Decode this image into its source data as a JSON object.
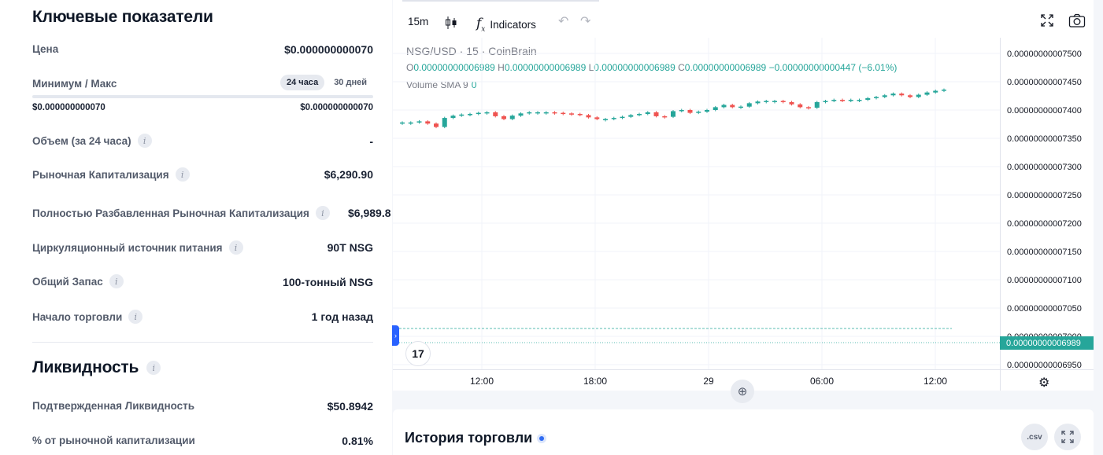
{
  "key_metrics": {
    "title": "Ключевые показатели",
    "price_label": "Цена",
    "price_value": "$0.000000000070",
    "minmax_label": "Минимум / Макс",
    "range_tabs": [
      "24 часа",
      "30 дней"
    ],
    "range_min": "$0.000000000070",
    "range_max": "$0.000000000070",
    "volume_label": "Объем (за 24 часа)",
    "volume_value": "-",
    "market_cap_label": "Рыночная Капитализация",
    "market_cap_value": "$6,290.90",
    "fdv_label": "Полностью Разбавленная Рыночная Капитализация",
    "fdv_value": "$6,989.8",
    "circulating_label": "Циркуляционный источник питания",
    "circulating_value": "90T NSG",
    "total_supply_label": "Общий Запас",
    "total_supply_value": "100-тонный NSG",
    "trading_start_label": "Начало торговли",
    "trading_start_value": "1 год назад",
    "info_icon_text": "i"
  },
  "liquidity": {
    "title": "Ликвидность",
    "confirmed_label": "Подтвержденная Ликвидность",
    "confirmed_value": "$50.8942",
    "pct_label": "% от рыночной капитализации",
    "pct_value": "0.81%"
  },
  "chart": {
    "toolbar": {
      "interval": "15m",
      "indicators_label": "Indicators"
    },
    "legend_title": "NSG/USD · 15 · CoinBrain",
    "ohlc": {
      "o_label": "O",
      "o": "0.00000000006989",
      "h_label": "H",
      "h": "0.00000000006989",
      "l_label": "L",
      "l": "0.00000000006989",
      "c_label": "C",
      "c": "0.00000000006989",
      "change": "−0.00000000000447 (−6.01%)"
    },
    "volume_label": "Volume SMA 9",
    "volume_value": "0",
    "last_price_badge": "0.00000000006989",
    "logo_text": "17",
    "up_color": "#26a69a",
    "down_color": "#ef5350"
  },
  "chart_data": {
    "type": "candlestick",
    "y_ticks": [
      "0.00000000007500",
      "0.00000000007450",
      "0.00000000007400",
      "0.00000000007350",
      "0.00000000007300",
      "0.00000000007250",
      "0.00000000007200",
      "0.00000000007150",
      "0.00000000007100",
      "0.00000000007050",
      "0.00000000007000",
      "0.00000000006950"
    ],
    "x_ticks": [
      "12:00",
      "18:00",
      "29",
      "06:00",
      "12:00"
    ],
    "ylim": [
      6.94e-11,
      7.52e-11
    ],
    "close_series": [
      7378,
      7378,
      7380,
      7376,
      7370,
      7386,
      7390,
      7392,
      7393,
      7395,
      7396,
      7389,
      7384,
      7390,
      7394,
      7396,
      7396,
      7396,
      7395,
      7394,
      7393,
      7391,
      7387,
      7384,
      7384,
      7386,
      7388,
      7391,
      7393,
      7396,
      7389,
      7388,
      7398,
      7400,
      7395,
      7397,
      7400,
      7405,
      7409,
      7405,
      7406,
      7412,
      7415,
      7416,
      7416,
      7414,
      7410,
      7405,
      7404,
      7414,
      7416,
      7418,
      7417,
      7418,
      7418,
      7421,
      7423,
      7426,
      7429,
      7426,
      7423,
      7427,
      7431,
      7434,
      7436
    ],
    "close_scale_note": ""
  },
  "history": {
    "title": "История торговли",
    "csv_label": ".csv"
  }
}
